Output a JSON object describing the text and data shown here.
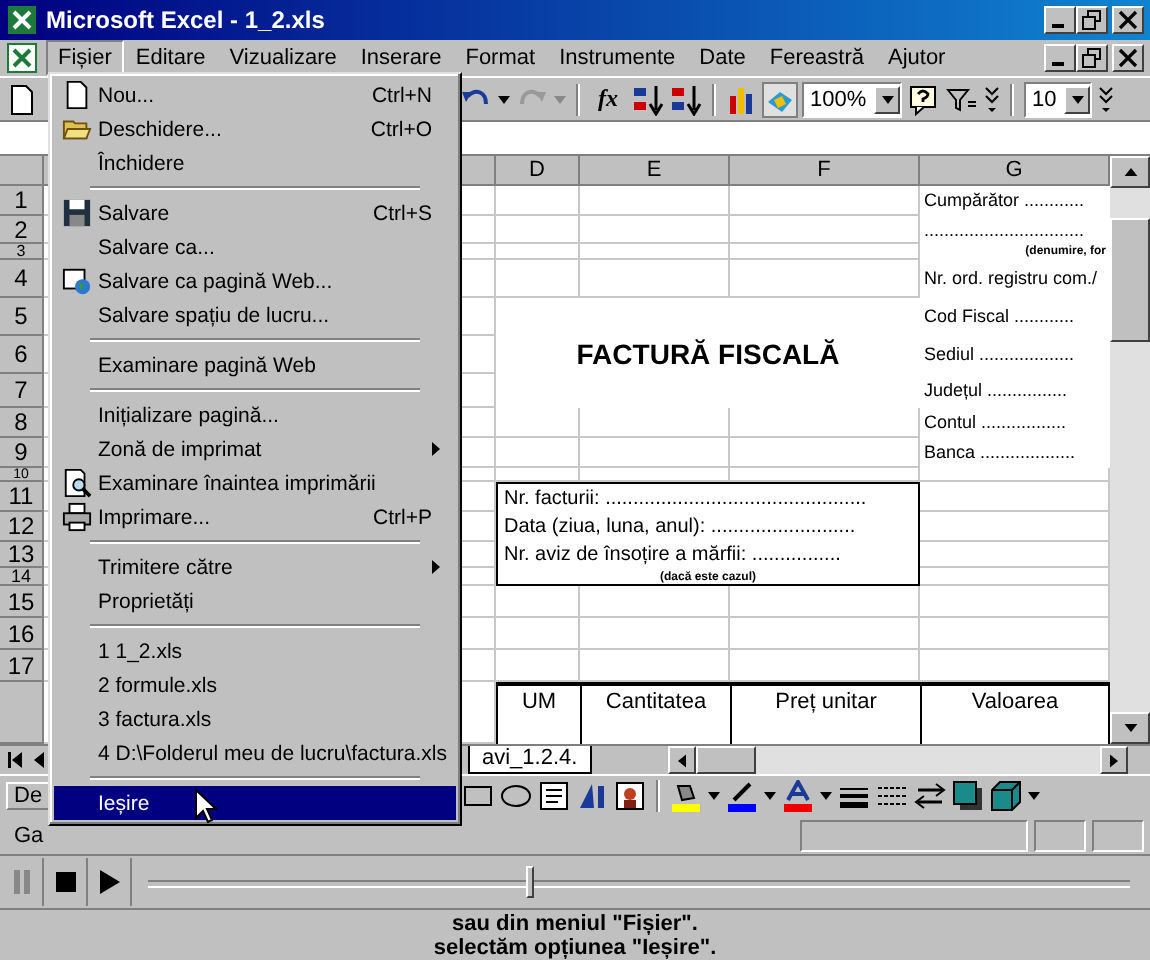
{
  "window": {
    "title": "Microsoft Excel - 1_2.xls"
  },
  "menu_bar": [
    {
      "label": "Fișier",
      "selected": true
    },
    {
      "label": "Editare",
      "selected": false
    },
    {
      "label": "Vizualizare",
      "selected": false
    },
    {
      "label": "Inserare",
      "selected": false
    },
    {
      "label": "Format",
      "selected": false
    },
    {
      "label": "Instrumente",
      "selected": false
    },
    {
      "label": "Date",
      "selected": false
    },
    {
      "label": "Fereastră",
      "selected": false
    },
    {
      "label": "Ajutor",
      "selected": false
    }
  ],
  "toolbar": {
    "function_label": "fx",
    "zoom": "100%",
    "font_size": "10"
  },
  "sheet": {
    "columns": [
      "D",
      "E",
      "F",
      "G"
    ],
    "rows": [
      "1",
      "2",
      "3",
      "4",
      "5",
      "6",
      "7",
      "8",
      "9",
      "10",
      "11",
      "12",
      "13",
      "14",
      "15",
      "16",
      "17"
    ],
    "buyer_lines": [
      {
        "kind": "line",
        "text": "Cumpărător ............"
      },
      {
        "kind": "line",
        "text": "................................"
      },
      {
        "kind": "note",
        "text": "(denumire, for"
      },
      {
        "kind": "line",
        "text": "Nr. ord. registru com./"
      },
      {
        "kind": "line",
        "text": "Cod Fiscal ............"
      },
      {
        "kind": "line",
        "text": "Sediul ..................."
      },
      {
        "kind": "line",
        "text": "Județul ................"
      },
      {
        "kind": "line",
        "text": "Contul ................."
      },
      {
        "kind": "line",
        "text": "Banca ..................."
      }
    ],
    "title": "FACTURĂ FISCALĂ",
    "invoice_box": {
      "lines": [
        "Nr. facturii: ...............................................",
        "Data (ziua, luna, anul): ..........................",
        "Nr. aviz de însoțire a mărfii: ................"
      ],
      "note": "(dacă este cazul)"
    },
    "table_header": [
      "UM",
      "Cantitatea",
      "Preț unitar",
      "Valoarea"
    ],
    "sheet_tab": "avi_1.2.4."
  },
  "drawing_toolbar": {
    "label": "De"
  },
  "status_bar": {
    "text": "Ga"
  },
  "file_menu": [
    {
      "kind": "item",
      "label": "Nou...",
      "shortcut": "Ctrl+N",
      "submenu": false,
      "selected": false
    },
    {
      "kind": "item",
      "label": "Deschidere...",
      "shortcut": "Ctrl+O",
      "submenu": false,
      "selected": false
    },
    {
      "kind": "item",
      "label": "Închidere",
      "submenu": false,
      "selected": false
    },
    {
      "kind": "separator"
    },
    {
      "kind": "item",
      "label": "Salvare",
      "shortcut": "Ctrl+S",
      "submenu": false,
      "selected": false
    },
    {
      "kind": "item",
      "label": "Salvare ca...",
      "submenu": false,
      "selected": false
    },
    {
      "kind": "item",
      "label": "Salvare ca pagină Web...",
      "submenu": false,
      "selected": false
    },
    {
      "kind": "item",
      "label": "Salvare spațiu de lucru...",
      "submenu": false,
      "selected": false
    },
    {
      "kind": "separator"
    },
    {
      "kind": "item",
      "label": "Examinare pagină Web",
      "submenu": false,
      "selected": false
    },
    {
      "kind": "separator"
    },
    {
      "kind": "item",
      "label": "Inițializare pagină...",
      "submenu": false,
      "selected": false
    },
    {
      "kind": "item",
      "label": "Zonă de imprimat",
      "submenu": true,
      "selected": false
    },
    {
      "kind": "item",
      "label": "Examinare înaintea imprimării",
      "submenu": false,
      "selected": false
    },
    {
      "kind": "item",
      "label": "Imprimare...",
      "shortcut": "Ctrl+P",
      "submenu": false,
      "selected": false
    },
    {
      "kind": "separator"
    },
    {
      "kind": "item",
      "label": "Trimitere către",
      "submenu": true,
      "selected": false
    },
    {
      "kind": "item",
      "label": "Proprietăți",
      "submenu": false,
      "selected": false
    },
    {
      "kind": "separator"
    },
    {
      "kind": "item",
      "label": "1 1_2.xls",
      "submenu": false,
      "selected": false
    },
    {
      "kind": "item",
      "label": "2 formule.xls",
      "submenu": false,
      "selected": false
    },
    {
      "kind": "item",
      "label": "3 factura.xls",
      "submenu": false,
      "selected": false
    },
    {
      "kind": "item",
      "label": "4 D:\\Folderul meu de lucru\\factura.xls",
      "submenu": false,
      "selected": false
    },
    {
      "kind": "separator"
    },
    {
      "kind": "item",
      "label": "Ieșire",
      "submenu": false,
      "selected": true
    }
  ],
  "player": {
    "level": 0.39
  },
  "caption": [
    "sau din meniul \"Fișier\".",
    "selectăm opțiunea \"Ieșire\"."
  ]
}
